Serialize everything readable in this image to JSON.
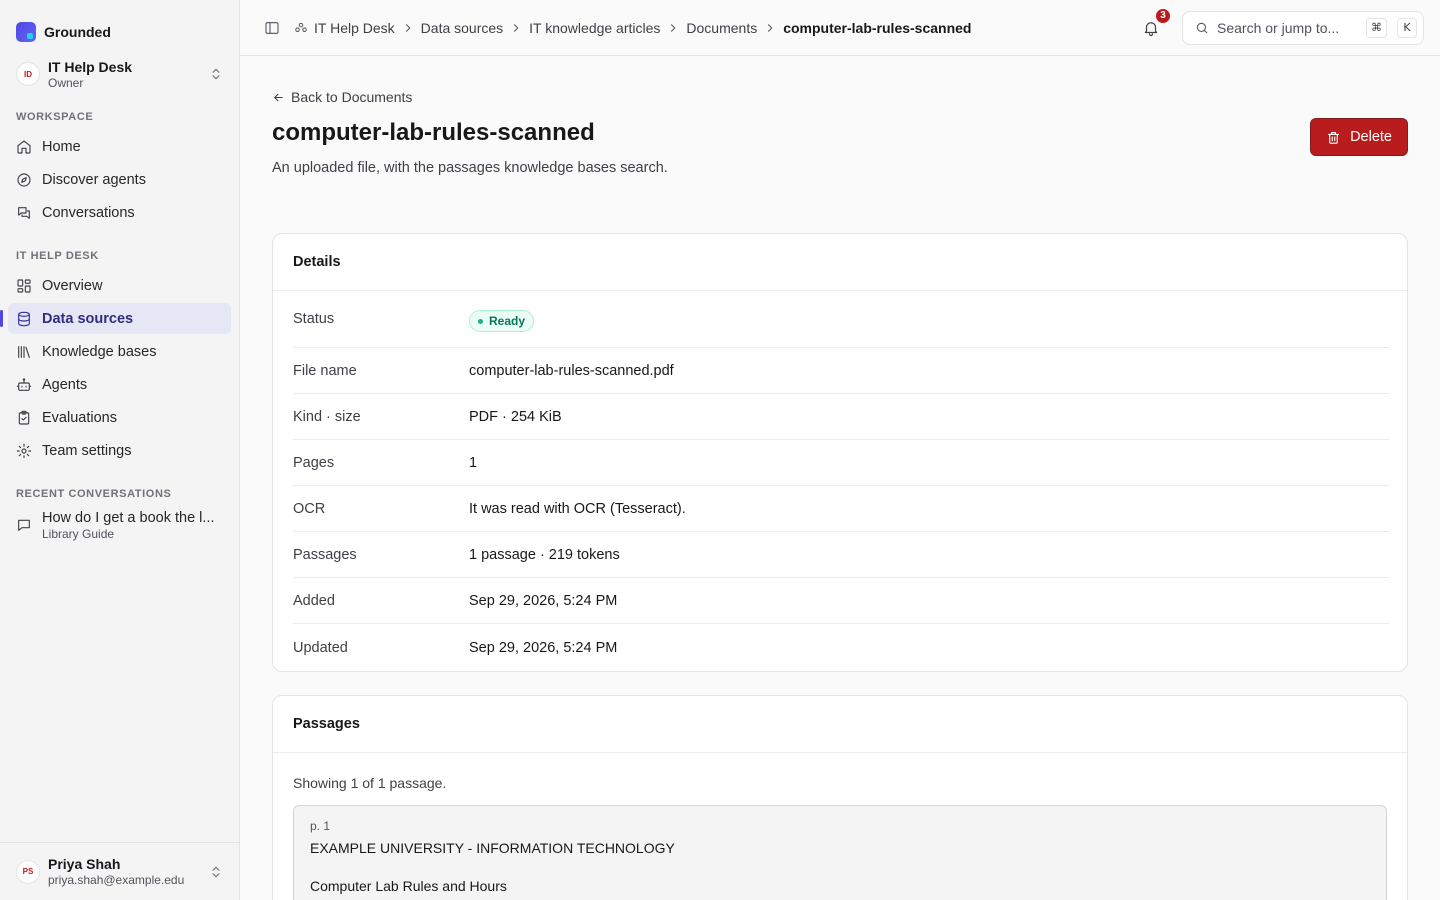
{
  "brand": {
    "name": "Grounded"
  },
  "team": {
    "avatar": "ID",
    "name": "IT Help Desk",
    "role": "Owner"
  },
  "sections": {
    "workspace": "WORKSPACE",
    "team": "IT HELP DESK",
    "recent": "RECENT CONVERSATIONS"
  },
  "workspace_nav": [
    {
      "label": "Home",
      "icon": "home-icon"
    },
    {
      "label": "Discover agents",
      "icon": "compass-icon"
    },
    {
      "label": "Conversations",
      "icon": "chat-icon"
    }
  ],
  "team_nav": [
    {
      "label": "Overview",
      "icon": "grid-icon"
    },
    {
      "label": "Data sources",
      "icon": "database-icon",
      "active": true
    },
    {
      "label": "Knowledge bases",
      "icon": "library-icon"
    },
    {
      "label": "Agents",
      "icon": "bot-icon"
    },
    {
      "label": "Evaluations",
      "icon": "clipboard-check-icon"
    },
    {
      "label": "Team settings",
      "icon": "gear-icon"
    }
  ],
  "recent": [
    {
      "title": "How do I get a book the l...",
      "subtitle": "Library Guide"
    }
  ],
  "user": {
    "avatar": "PS",
    "name": "Priya Shah",
    "email": "priya.shah@example.edu"
  },
  "breadcrumbs": [
    "IT Help Desk",
    "Data sources",
    "IT knowledge articles",
    "Documents",
    "computer-lab-rules-scanned"
  ],
  "notifications": {
    "count": "3"
  },
  "search": {
    "placeholder": "Search or jump to...",
    "kbd_mod": "⌘",
    "kbd_key": "K"
  },
  "page": {
    "back_label": "Back to Documents",
    "title": "computer-lab-rules-scanned",
    "subtitle": "An uploaded file, with the passages knowledge bases search.",
    "delete_label": "Delete"
  },
  "details": {
    "heading": "Details",
    "status_label": "Status",
    "status_value": "Ready",
    "rows": [
      {
        "label": "File name",
        "value": "computer-lab-rules-scanned.pdf"
      },
      {
        "label": "Kind · size",
        "value": "PDF · 254 KiB"
      },
      {
        "label": "Pages",
        "value": "1"
      },
      {
        "label": "OCR",
        "value": "It was read with OCR (Tesseract)."
      },
      {
        "label": "Passages",
        "value": "1 passage · 219 tokens"
      },
      {
        "label": "Added",
        "value": "Sep 29, 2026, 5:24 PM"
      },
      {
        "label": "Updated",
        "value": "Sep 29, 2026, 5:24 PM"
      }
    ]
  },
  "passages": {
    "heading": "Passages",
    "showing": "Showing 1 of 1 passage.",
    "items": [
      {
        "page": "p. 1",
        "line1": "EXAMPLE UNIVERSITY - INFORMATION TECHNOLOGY",
        "line2": "Computer Lab Rules and Hours"
      }
    ]
  },
  "colors": {
    "accent": "#4f46e5",
    "danger": "#b91c1c",
    "success": "#047857"
  }
}
